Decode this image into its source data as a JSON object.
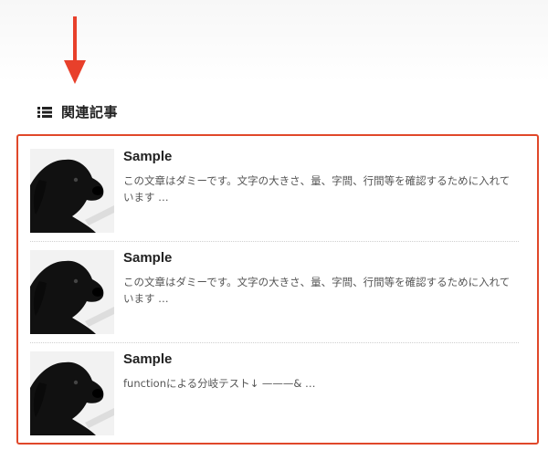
{
  "heading": {
    "icon": "list-icon",
    "title": "関連記事"
  },
  "annotation": {
    "arrow_color": "#e8402b",
    "box_color": "#e0482a"
  },
  "related_posts": [
    {
      "title": "Sample",
      "excerpt": "この文章はダミーです。文字の大きさ、量、字間、行間等を確認するために入れています …",
      "thumbnail": "black-dog-photo"
    },
    {
      "title": "Sample",
      "excerpt": "この文章はダミーです。文字の大きさ、量、字間、行間等を確認するために入れています …",
      "thumbnail": "black-dog-photo"
    },
    {
      "title": "Sample",
      "excerpt": "functionによる分岐テスト↓ ———& …",
      "thumbnail": "black-dog-photo"
    }
  ]
}
